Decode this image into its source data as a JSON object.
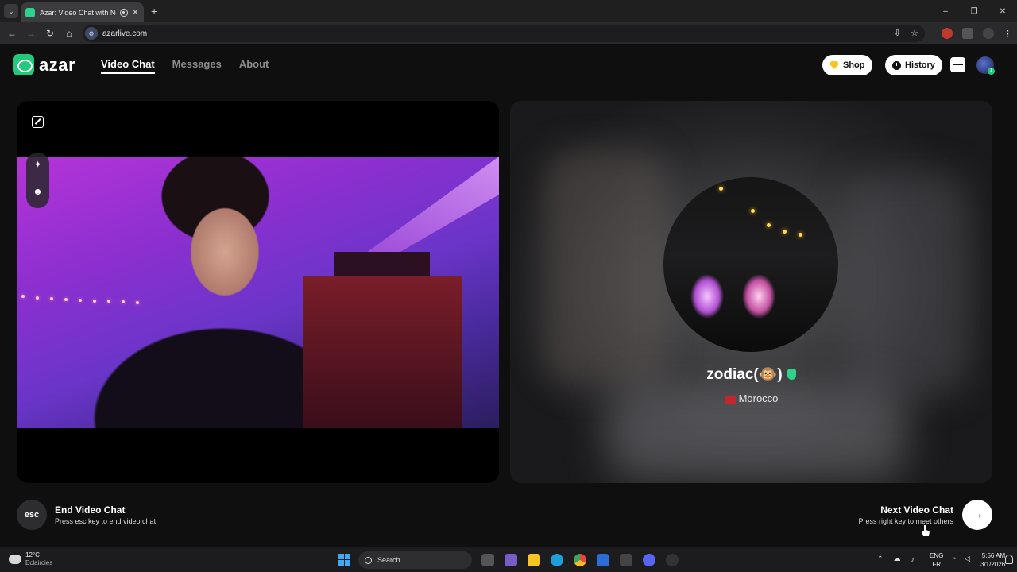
{
  "browser": {
    "tab_title": "Azar: Video Chat with New",
    "url": "azarlive.com",
    "window_controls": [
      "–",
      "❐",
      "✕"
    ]
  },
  "header": {
    "logo_text": "azar",
    "nav": [
      {
        "label": "Video Chat",
        "active": true
      },
      {
        "label": "Messages",
        "active": false
      },
      {
        "label": "About",
        "active": false
      }
    ],
    "shop_label": "Shop",
    "history_label": "History",
    "avatar_badge": "1"
  },
  "remote": {
    "name": "zodiac(🐵)",
    "country": "Morocco",
    "verified": true
  },
  "controls": {
    "esc_label": "esc",
    "end_title": "End Video Chat",
    "end_subtitle": "Press esc key to end video chat",
    "next_title": "Next Video Chat",
    "next_subtitle": "Press right key to meet others",
    "next_arrow": "→"
  },
  "taskbar": {
    "weather_temp": "12°C",
    "weather_desc": "Eclaircies",
    "search_placeholder": "Search",
    "lang_primary": "ENG",
    "lang_secondary": "FR",
    "time": "5:56 AM",
    "date": "3/1/2026"
  },
  "colors": {
    "brand_green": "#22c97a",
    "background": "#0f0f10"
  }
}
